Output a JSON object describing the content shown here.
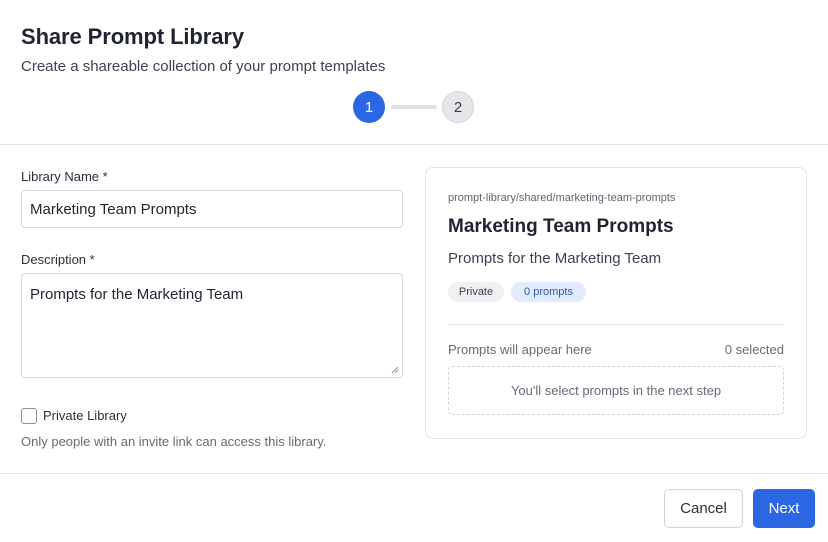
{
  "dialog": {
    "title": "Share Prompt Library",
    "subtitle": "Create a shareable collection of your prompt templates"
  },
  "stepper": {
    "current": 1,
    "steps": [
      {
        "label": "1",
        "state": "active"
      },
      {
        "label": "2",
        "state": "upcoming"
      }
    ]
  },
  "form": {
    "library_name": {
      "label": "Library Name *",
      "value": "Marketing Team Prompts"
    },
    "description": {
      "label": "Description *",
      "value": "Prompts for the Marketing Team"
    },
    "private": {
      "label": "Private Library",
      "checked": false,
      "helper": "Only people with an invite link can access this library."
    }
  },
  "preview": {
    "path": "prompt-library/shared/marketing-team-prompts",
    "title": "Marketing Team Prompts",
    "description": "Prompts for the Marketing Team",
    "badges": {
      "privacy": "Private",
      "count": "0 prompts"
    },
    "note": "Prompts will appear here",
    "selected": "0 selected",
    "placeholder": "You'll select prompts in the next step"
  },
  "footer": {
    "cancel_label": "Cancel",
    "next_label": "Next"
  },
  "colors": {
    "accent": "#2b66e3",
    "badge_count_bg": "#e2ebfb"
  }
}
